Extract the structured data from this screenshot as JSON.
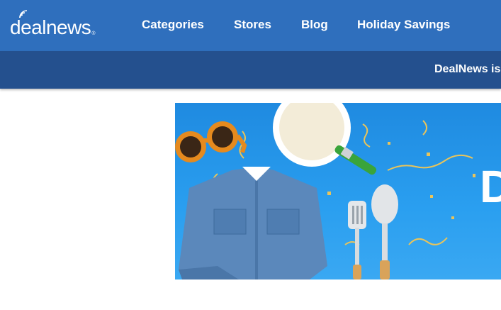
{
  "header": {
    "logo_text": "dealnews",
    "logo_registered": "®",
    "nav": [
      {
        "label": "Categories"
      },
      {
        "label": "Stores"
      },
      {
        "label": "Blog"
      },
      {
        "label": "Holiday Savings"
      }
    ]
  },
  "subbar": {
    "promo_text": "DealNews is"
  },
  "hero": {
    "overlay_text": "D",
    "icons": [
      "sunglasses-icon",
      "frying-pan-icon",
      "denim-shirt-icon",
      "spatula-icon",
      "spoon-icon",
      "confetti-icon"
    ]
  },
  "colors": {
    "topbar": "#2f6fbd",
    "subbar": "#24508e",
    "hero_bg": "#2a9ff0"
  }
}
